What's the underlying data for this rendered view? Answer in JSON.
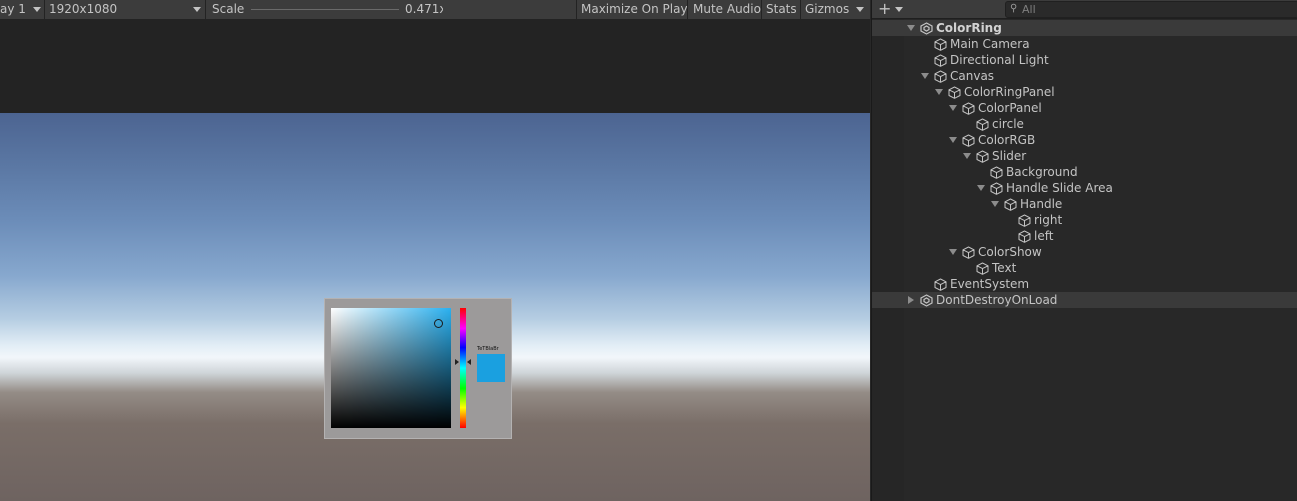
{
  "game_toolbar": {
    "display_label": "ay 1",
    "resolution_label": "1920x1080",
    "scale_label": "Scale",
    "scale_value": "0.471x",
    "maximize_on_play": "Maximize On Play",
    "mute_audio": "Mute Audio",
    "stats": "Stats",
    "gizmos": "Gizmos"
  },
  "color_picker": {
    "selected_color": "#1aa0e0",
    "color_text": "TeTBlaBr"
  },
  "hierarchy": {
    "add_icon": "plus-icon",
    "search_placeholder": "All",
    "items": [
      {
        "label": "ColorRing",
        "depth": 0,
        "fold": "open",
        "scene": true
      },
      {
        "label": "Main Camera",
        "depth": 1,
        "fold": "none"
      },
      {
        "label": "Directional Light",
        "depth": 1,
        "fold": "none"
      },
      {
        "label": "Canvas",
        "depth": 1,
        "fold": "open"
      },
      {
        "label": "ColorRingPanel",
        "depth": 2,
        "fold": "open"
      },
      {
        "label": "ColorPanel",
        "depth": 3,
        "fold": "open"
      },
      {
        "label": "circle",
        "depth": 4,
        "fold": "none"
      },
      {
        "label": "ColorRGB",
        "depth": 3,
        "fold": "open"
      },
      {
        "label": "Slider",
        "depth": 4,
        "fold": "open"
      },
      {
        "label": "Background",
        "depth": 5,
        "fold": "none"
      },
      {
        "label": "Handle Slide Area",
        "depth": 5,
        "fold": "open"
      },
      {
        "label": "Handle",
        "depth": 6,
        "fold": "open"
      },
      {
        "label": "right",
        "depth": 7,
        "fold": "none"
      },
      {
        "label": "left",
        "depth": 7,
        "fold": "none"
      },
      {
        "label": "ColorShow",
        "depth": 3,
        "fold": "open"
      },
      {
        "label": "Text",
        "depth": 4,
        "fold": "none"
      },
      {
        "label": "EventSystem",
        "depth": 1,
        "fold": "none"
      },
      {
        "label": "DontDestroyOnLoad",
        "depth": 0,
        "fold": "closed",
        "scene": true
      }
    ]
  }
}
